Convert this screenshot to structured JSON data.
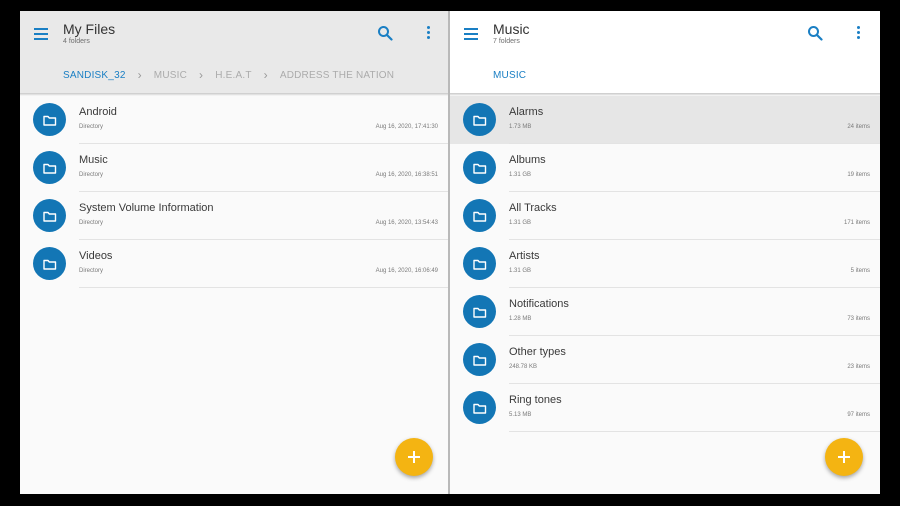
{
  "colors": {
    "accent": "#1a7fc4",
    "folder_badge": "#1376b5",
    "fab": "#f4b412"
  },
  "left_pane": {
    "title": "My Files",
    "subtitle": "4 folders",
    "breadcrumb": [
      "SANDISK_32",
      "MUSIC",
      "H.E.A.T",
      "ADDRESS THE NATION"
    ],
    "items": [
      {
        "name": "Android",
        "meta": "Directory",
        "right": "Aug 16, 2020, 17:41:30"
      },
      {
        "name": "Music",
        "meta": "Directory",
        "right": "Aug 16, 2020, 16:38:51"
      },
      {
        "name": "System Volume Information",
        "meta": "Directory",
        "right": "Aug 16, 2020, 13:54:43"
      },
      {
        "name": "Videos",
        "meta": "Directory",
        "right": "Aug 16, 2020, 16:06:49"
      }
    ]
  },
  "right_pane": {
    "title": "Music",
    "subtitle": "7 folders",
    "breadcrumb": [
      "MUSIC"
    ],
    "items": [
      {
        "name": "Alarms",
        "meta": "1.73 MB",
        "right": "24 items"
      },
      {
        "name": "Albums",
        "meta": "1.31 GB",
        "right": "19 items"
      },
      {
        "name": "All Tracks",
        "meta": "1.31 GB",
        "right": "171 items"
      },
      {
        "name": "Artists",
        "meta": "1.31 GB",
        "right": "5 items"
      },
      {
        "name": "Notifications",
        "meta": "1.28 MB",
        "right": "73 items"
      },
      {
        "name": "Other types",
        "meta": "248.78 KB",
        "right": "23 items"
      },
      {
        "name": "Ring tones",
        "meta": "5.13 MB",
        "right": "97 items"
      }
    ]
  },
  "icons": {
    "menu": "hamburger-menu-icon",
    "search": "search-icon",
    "more": "more-vert-icon",
    "folder": "folder-icon",
    "add": "add-icon",
    "breadcrumb_separator": "chevron-right-icon"
  }
}
